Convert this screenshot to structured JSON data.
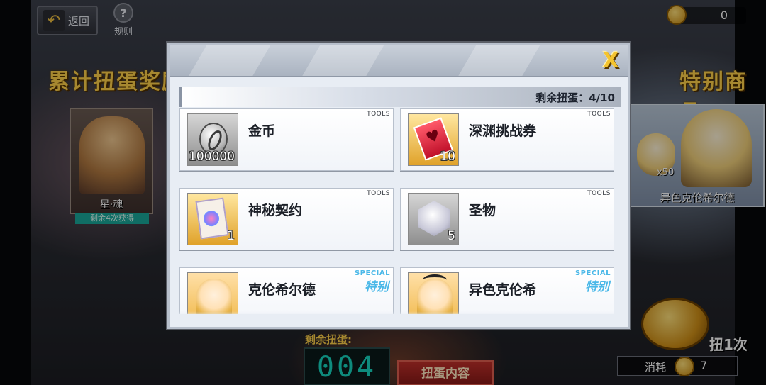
{
  "topbar": {
    "back_label": "返回",
    "rules_label": "规则",
    "coin_value": "0"
  },
  "left_panel": {
    "title": "累计扭蛋奖励",
    "reward_name": "星·魂",
    "reward_tag": "剩余4次获得"
  },
  "right_panel": {
    "title": "特别商品",
    "mini_count": "x50",
    "reward_name": "异色克伦希尔德"
  },
  "bottom": {
    "remaining_label": "剩余扭蛋:",
    "remaining_counter": "004",
    "content_button": "扭蛋内容",
    "spin_label": "扭1次",
    "cost_label": "消耗",
    "cost_value": "7"
  },
  "modal": {
    "close_label": "X",
    "remaining_text": "剩余扭蛋：4/10",
    "items": [
      {
        "name": "金币",
        "qty": "100000",
        "tag": "TOOLS",
        "icon": "silver-coin-icon"
      },
      {
        "name": "深渊挑战券",
        "qty": "10",
        "tag": "TOOLS",
        "icon": "abyss-ticket-icon"
      },
      {
        "name": "神秘契约",
        "qty": "1",
        "tag": "TOOLS",
        "icon": "contract-scroll-icon"
      },
      {
        "name": "圣物",
        "qty": "5",
        "tag": "TOOLS",
        "icon": "crystal-hexagon-icon"
      },
      {
        "name": "克伦希尔德",
        "qty": "",
        "tag": "SPECIAL",
        "tag2": "特别",
        "icon": "character-portrait-icon"
      },
      {
        "name": "异色克伦希",
        "qty": "",
        "tag": "SPECIAL",
        "tag2": "特别",
        "icon": "character-portrait-alt-icon"
      }
    ]
  }
}
